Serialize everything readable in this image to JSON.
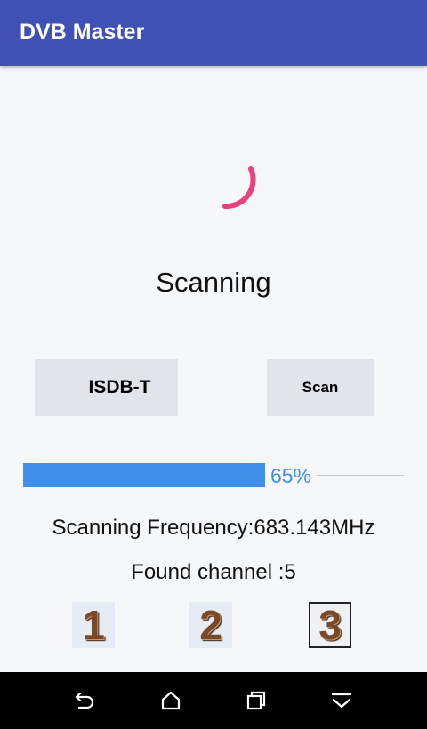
{
  "app_bar": {
    "title": "DVB Master",
    "color": "#3f51b5"
  },
  "spinner": {
    "icon": "loading-spinner-icon",
    "color": "#ec407a"
  },
  "status": {
    "text": "Scanning"
  },
  "controls": {
    "standard_label": "ISDB-T",
    "scan_label": "Scan"
  },
  "progress": {
    "value": 65,
    "label": "65%",
    "color": "#3f8ee8"
  },
  "scan_info": {
    "frequency_text": "Scanning Frequency:683.143MHz",
    "found_text": "Found channel :5"
  },
  "steps": [
    {
      "label": "1",
      "selected": false
    },
    {
      "label": "2",
      "selected": false
    },
    {
      "label": "3",
      "selected": true
    }
  ],
  "nav_bar": {
    "buttons": [
      "back-icon",
      "home-icon",
      "recent-apps-icon",
      "menu-down-icon"
    ]
  }
}
